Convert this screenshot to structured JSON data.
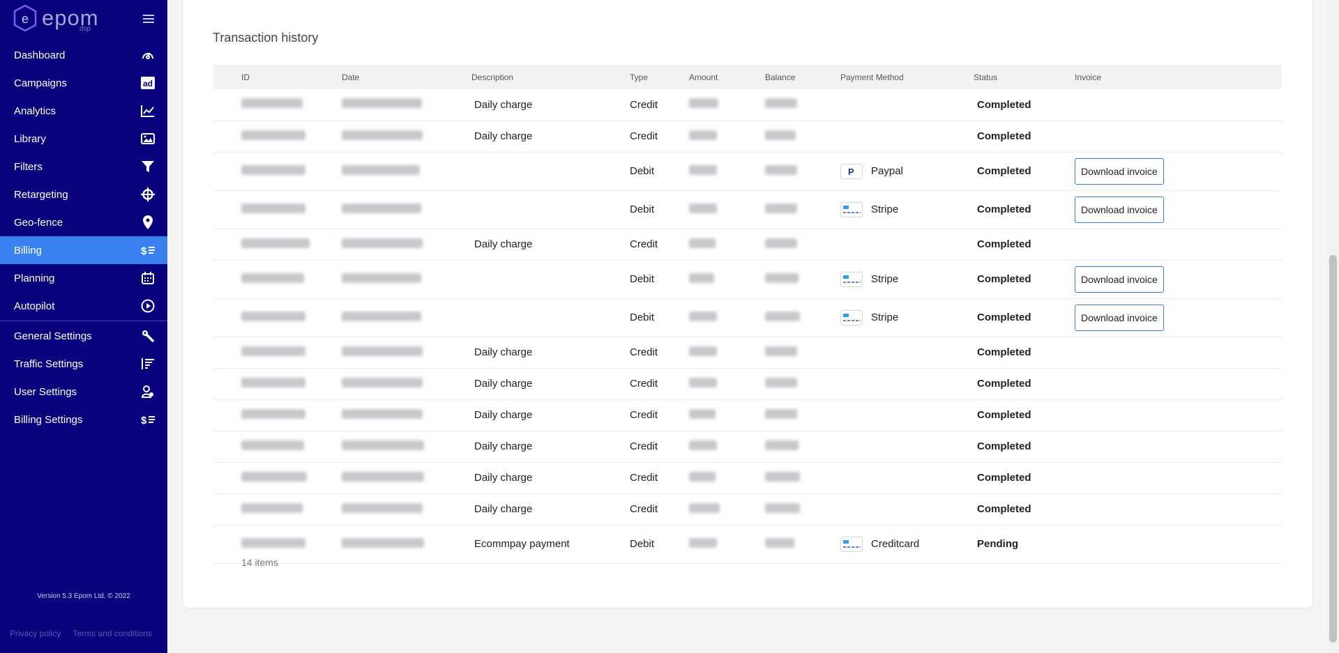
{
  "sidebar": {
    "logo_text": "epom",
    "logo_sub": "dsp",
    "nav_items": [
      {
        "label": "Dashboard",
        "icon": "gauge-icon"
      },
      {
        "label": "Campaigns",
        "icon": "ad-icon"
      },
      {
        "label": "Analytics",
        "icon": "chart-icon"
      },
      {
        "label": "Library",
        "icon": "image-icon"
      },
      {
        "label": "Filters",
        "icon": "funnel-icon"
      },
      {
        "label": "Retargeting",
        "icon": "crosshair-icon"
      },
      {
        "label": "Geo-fence",
        "icon": "map-pin-icon"
      },
      {
        "label": "Billing",
        "icon": "dollar-list-icon",
        "active": true
      },
      {
        "label": "Planning",
        "icon": "calendar-icon"
      },
      {
        "label": "Autopilot",
        "icon": "play-circle-icon"
      }
    ],
    "settings_items": [
      {
        "label": "General Settings",
        "icon": "wrench-icon"
      },
      {
        "label": "Traffic Settings",
        "icon": "list-bars-icon"
      },
      {
        "label": "User Settings",
        "icon": "user-gear-icon"
      },
      {
        "label": "Billing Settings",
        "icon": "dollar-list-icon"
      }
    ],
    "version": "Version 5.3 Epom Ltd. © 2022",
    "footer": {
      "privacy": "Privacy policy",
      "terms": "Terms and conditions"
    }
  },
  "main": {
    "title": "Transaction history",
    "columns": [
      "ID",
      "Date",
      "Description",
      "Type",
      "Amount",
      "Balance",
      "Payment Method",
      "Status",
      "Invoice"
    ],
    "rows": [
      {
        "description": "Daily charge",
        "type": "Credit",
        "method": "",
        "status": "Completed",
        "invoice": ""
      },
      {
        "description": "Daily charge",
        "type": "Credit",
        "method": "",
        "status": "Completed",
        "invoice": ""
      },
      {
        "description": "",
        "type": "Debit",
        "method": "Paypal",
        "method_icon": "paypal-icon",
        "status": "Completed",
        "invoice": "Download invoice"
      },
      {
        "description": "",
        "type": "Debit",
        "method": "Stripe",
        "method_icon": "card-icon",
        "status": "Completed",
        "invoice": "Download invoice"
      },
      {
        "description": "Daily charge",
        "type": "Credit",
        "method": "",
        "status": "Completed",
        "invoice": ""
      },
      {
        "description": "",
        "type": "Debit",
        "method": "Stripe",
        "method_icon": "card-icon",
        "status": "Completed",
        "invoice": "Download invoice"
      },
      {
        "description": "",
        "type": "Debit",
        "method": "Stripe",
        "method_icon": "card-icon",
        "status": "Completed",
        "invoice": "Download invoice"
      },
      {
        "description": "Daily charge",
        "type": "Credit",
        "method": "",
        "status": "Completed",
        "invoice": ""
      },
      {
        "description": "Daily charge",
        "type": "Credit",
        "method": "",
        "status": "Completed",
        "invoice": ""
      },
      {
        "description": "Daily charge",
        "type": "Credit",
        "method": "",
        "status": "Completed",
        "invoice": ""
      },
      {
        "description": "Daily charge",
        "type": "Credit",
        "method": "",
        "status": "Completed",
        "invoice": ""
      },
      {
        "description": "Daily charge",
        "type": "Credit",
        "method": "",
        "status": "Completed",
        "invoice": ""
      },
      {
        "description": "Daily charge",
        "type": "Credit",
        "method": "",
        "status": "Completed",
        "invoice": ""
      },
      {
        "description": "Ecommpay payment",
        "type": "Debit",
        "method": "Creditcard",
        "method_icon": "card-icon",
        "status": "Pending",
        "invoice": ""
      }
    ],
    "items_count": "14 items"
  },
  "colors": {
    "sidebar_bg": "#08037d",
    "active_bg": "#3a82f0",
    "button_border": "#3a7bd5"
  }
}
